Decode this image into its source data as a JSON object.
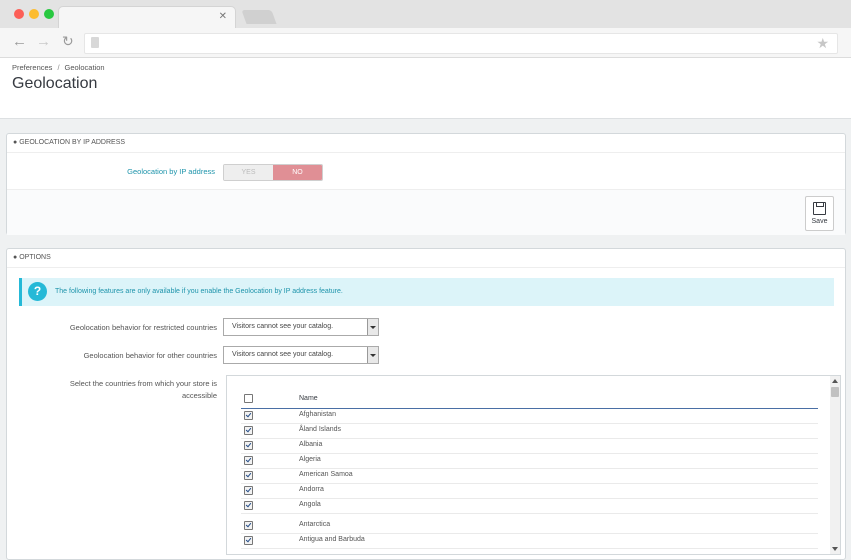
{
  "colors": {
    "accent": "#25b9d7",
    "no_active": "#e08f95",
    "window_red": "#fc5f57",
    "window_yellow": "#fdbc2e",
    "window_green": "#28c840"
  },
  "browser": {
    "icons": [
      "back-arrow-icon",
      "forward-arrow-icon",
      "reload-icon",
      "page-icon",
      "bookmark-star-icon"
    ],
    "tab_close": "✕"
  },
  "breadcrumb": {
    "parent": "Preferences",
    "separator": "/",
    "current": "Geolocation"
  },
  "page_title": "Geolocation",
  "panel_ip": {
    "heading": "GEOLOCATION BY IP ADDRESS",
    "field_label": "Geolocation by IP address",
    "yes": "YES",
    "no": "NO",
    "selected": "NO",
    "save": "Save"
  },
  "panel_options": {
    "heading": "OPTIONS",
    "alert": "The following features are only available if you enable the Geolocation by IP address feature.",
    "restricted_label": "Geolocation behavior for restricted countries",
    "restricted_value": "Visitors cannot see your catalog.",
    "other_label": "Geolocation behavior for other countries",
    "other_value": "Visitors cannot see your catalog.",
    "countries_label_1": "Select the countries from which your store is",
    "countries_label_2": "accessible",
    "name_header": "Name",
    "countries": [
      {
        "name": "Afghanistan",
        "checked": true
      },
      {
        "name": "Åland Islands",
        "checked": true
      },
      {
        "name": "Albania",
        "checked": true
      },
      {
        "name": "Algeria",
        "checked": true
      },
      {
        "name": "American Samoa",
        "checked": true
      },
      {
        "name": "Andorra",
        "checked": true
      },
      {
        "name": "Angola",
        "checked": true
      },
      {
        "name": "Antarctica",
        "checked": true
      },
      {
        "name": "Antigua and Barbuda",
        "checked": true
      }
    ]
  }
}
